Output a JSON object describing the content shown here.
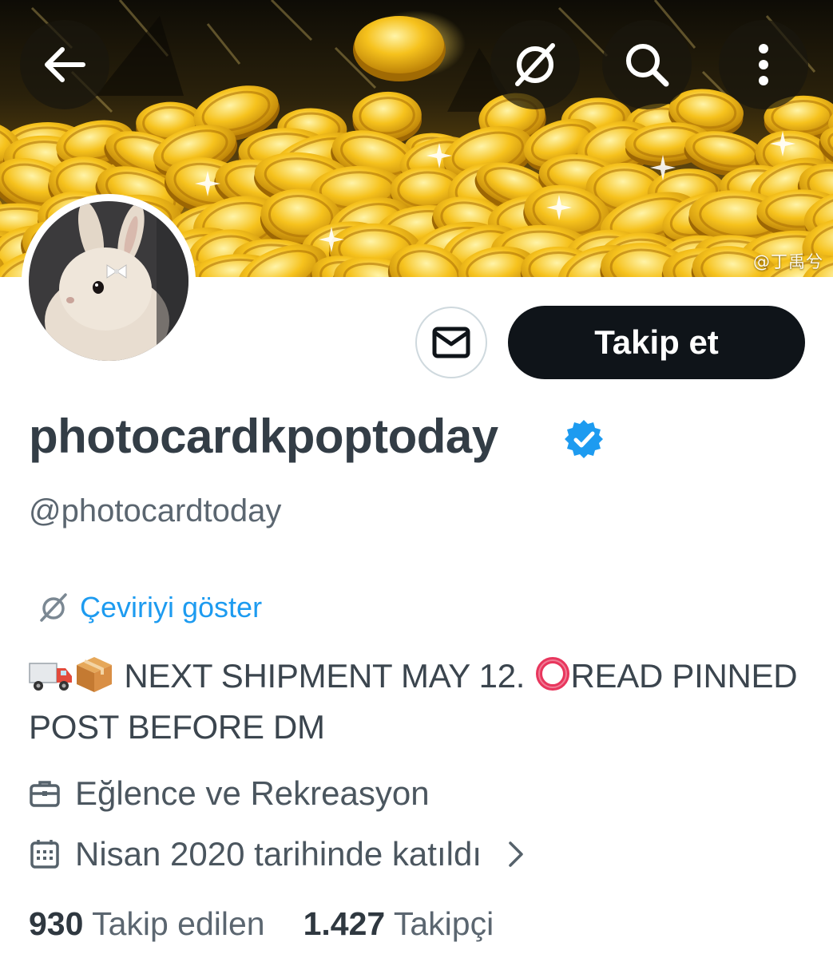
{
  "header": {
    "back_icon": "arrow-left-icon",
    "translate_icon": "globe-strike-icon",
    "search_icon": "search-icon",
    "more_icon": "more-vertical-icon",
    "banner_watermark": "@丁禹兮"
  },
  "actions": {
    "message_icon": "envelope-icon",
    "follow_label": "Takip et"
  },
  "profile": {
    "display_name": "photocardkpoptoday",
    "verified_icon": "verified-badge-icon",
    "verified_color": "#1d9bf0",
    "handle": "@photocardtoday",
    "translate_label": "Çeviriyi göster",
    "bio_emojis": [
      "truck-emoji",
      "package-emoji"
    ],
    "bio_part1": "NEXT SHIPMENT MAY 12.",
    "bio_ring_emoji": "hollow-red-circle-emoji",
    "bio_part2": "READ PINNED POST BEFORE DM",
    "category_icon": "briefcase-icon",
    "category": "Eğlence ve Rekreasyon",
    "joined_icon": "calendar-icon",
    "joined": "Nisan 2020 tarihinde katıldı"
  },
  "stats": {
    "following_count": "930",
    "following_label": "Takip edilen",
    "followers_count": "1.427",
    "followers_label": "Takipçi"
  },
  "colors": {
    "follow_button_bg": "#0f1419",
    "link": "#1d9bf0",
    "banner_gold": "#f0b414"
  }
}
